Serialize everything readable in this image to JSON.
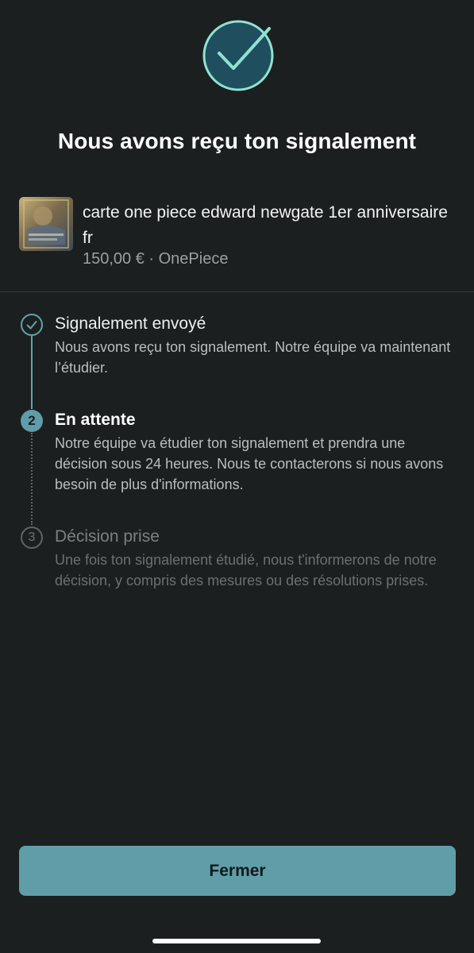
{
  "header": {
    "icon": "check-circle-icon",
    "title": "Nous avons reçu ton signalement"
  },
  "item": {
    "thumbnail": "card-image",
    "title": "carte one piece edward newgate 1er anniversaire fr",
    "meta": "150,00 € · OnePiece"
  },
  "steps": [
    {
      "marker": "check-icon",
      "title": "Signalement envoyé",
      "description": "Nous avons reçu ton signalement. Notre équipe va maintenant l’étudier.",
      "state": "done"
    },
    {
      "marker": "2",
      "title": "En attente",
      "description": "Notre équipe va étudier ton signalement et prendra une décision sous 24 heures. Nous te contacterons si nous avons besoin de plus d'informations.",
      "state": "current"
    },
    {
      "marker": "3",
      "title": "Décision prise",
      "description": "Une fois ton signalement étudié, nous t'informerons de notre décision, y compris des mesures ou des résolutions prises.",
      "state": "pending"
    }
  ],
  "footer": {
    "close_label": "Fermer"
  },
  "colors": {
    "background": "#1c1f20",
    "accent": "#5f9ea9",
    "icon_fill": "#1f4f5e"
  }
}
